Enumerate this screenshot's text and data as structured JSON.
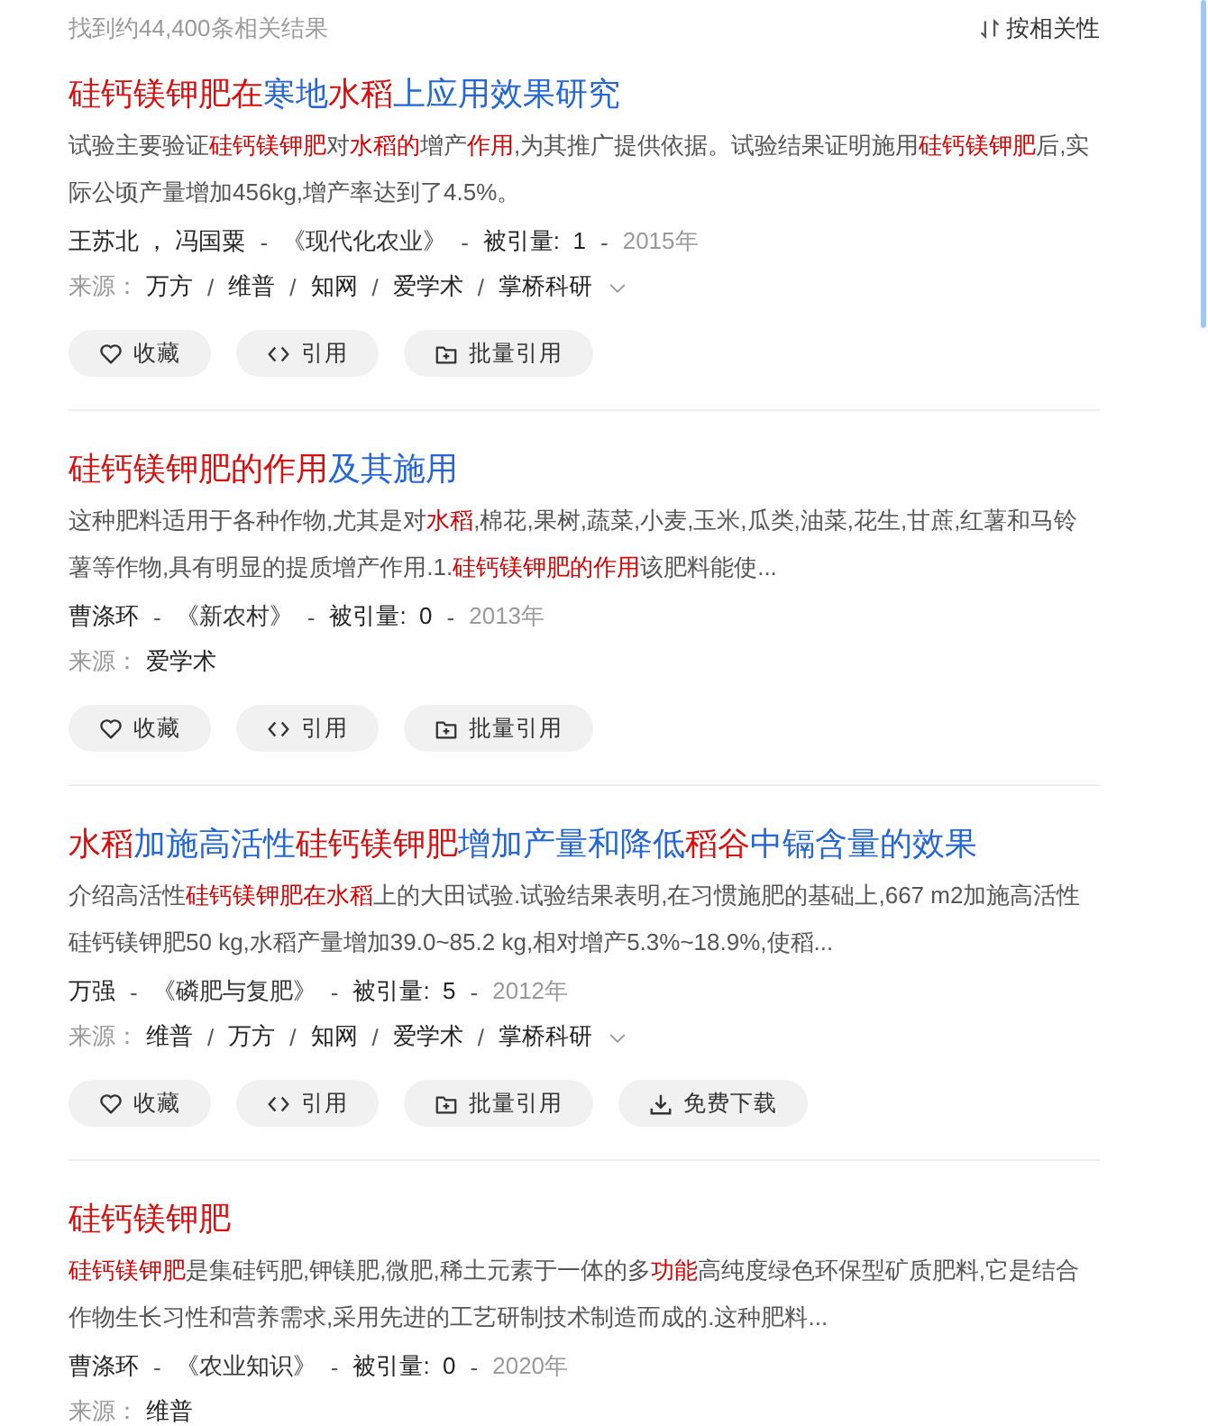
{
  "header": {
    "count": "找到约44,400条相关结果",
    "sort": "按相关性"
  },
  "results": [
    {
      "title": [
        {
          "text": "硅钙镁钾肥在",
          "highlight": true
        },
        {
          "text": "寒地",
          "highlight": false
        },
        {
          "text": "水稻",
          "highlight": true
        },
        {
          "text": "上应用效果研究",
          "highlight": false
        }
      ],
      "abstract": [
        {
          "text": "试验主要验证",
          "highlight": false
        },
        {
          "text": "硅钙镁钾肥",
          "highlight": true
        },
        {
          "text": "对",
          "highlight": false
        },
        {
          "text": "水稻的",
          "highlight": true
        },
        {
          "text": "增产",
          "highlight": false
        },
        {
          "text": "作用",
          "highlight": true
        },
        {
          "text": ",为其推广提供依据。试验结果证明施用",
          "highlight": false
        },
        {
          "text": "硅钙镁钾肥",
          "highlight": true
        },
        {
          "text": "后,实际公顷产量增加456kg,增产率达到了4.5%。",
          "highlight": false
        }
      ],
      "meta": [
        {
          "text": "王苏北 ， 冯国粟",
          "kind": "author"
        },
        {
          "text": "-",
          "kind": "sep"
        },
        {
          "text": "《现代化农业》",
          "kind": "journal"
        },
        {
          "text": "-",
          "kind": "sep"
        },
        {
          "text": "被引量:  1",
          "kind": "cited"
        },
        {
          "text": "-",
          "kind": "sep"
        },
        {
          "text": "2015年",
          "kind": "year"
        }
      ],
      "source": {
        "label": "来源：",
        "expandable": true,
        "items": [
          {
            "text": "万方",
            "kind": "site"
          },
          {
            "text": "/",
            "kind": "sep"
          },
          {
            "text": "维普",
            "kind": "site"
          },
          {
            "text": "/",
            "kind": "sep"
          },
          {
            "text": "知网",
            "kind": "site"
          },
          {
            "text": "/",
            "kind": "sep"
          },
          {
            "text": "爱学术",
            "kind": "site"
          },
          {
            "text": "/",
            "kind": "sep"
          },
          {
            "text": "掌桥科研",
            "kind": "site"
          }
        ]
      },
      "buttons": [
        {
          "label": "收藏",
          "kind": "favorite"
        },
        {
          "label": "引用",
          "kind": "cite"
        },
        {
          "label": "批量引用",
          "kind": "batch"
        }
      ]
    },
    {
      "title": [
        {
          "text": "硅钙镁钾肥的作用",
          "highlight": true
        },
        {
          "text": "及其施用",
          "highlight": false
        }
      ],
      "abstract": [
        {
          "text": "这种肥料适用于各种作物,尤其是对",
          "highlight": false
        },
        {
          "text": "水稻",
          "highlight": true
        },
        {
          "text": ",棉花,果树,蔬菜,小麦,玉米,瓜类,油菜,花生,甘蔗,红薯和马铃薯等作物,具有明显的提质增产作用.1.",
          "highlight": false
        },
        {
          "text": "硅钙镁钾肥的作用",
          "highlight": true
        },
        {
          "text": "该肥料能使...",
          "highlight": false
        }
      ],
      "meta": [
        {
          "text": "曹涤环",
          "kind": "author"
        },
        {
          "text": "-",
          "kind": "sep"
        },
        {
          "text": "《新农村》",
          "kind": "journal"
        },
        {
          "text": "-",
          "kind": "sep"
        },
        {
          "text": "被引量:  0",
          "kind": "cited"
        },
        {
          "text": "-",
          "kind": "sep"
        },
        {
          "text": "2013年",
          "kind": "year"
        }
      ],
      "source": {
        "label": "来源：",
        "expandable": false,
        "items": [
          {
            "text": "爱学术",
            "kind": "site"
          }
        ]
      },
      "buttons": [
        {
          "label": "收藏",
          "kind": "favorite"
        },
        {
          "label": "引用",
          "kind": "cite"
        },
        {
          "label": "批量引用",
          "kind": "batch"
        }
      ]
    },
    {
      "title": [
        {
          "text": "水稻",
          "highlight": true
        },
        {
          "text": "加施高活性",
          "highlight": false
        },
        {
          "text": "硅钙镁钾肥",
          "highlight": true
        },
        {
          "text": "增加产量和降低",
          "highlight": false
        },
        {
          "text": "稻谷",
          "highlight": true
        },
        {
          "text": "中镉含量的效果",
          "highlight": false
        }
      ],
      "abstract": [
        {
          "text": "介绍高活性",
          "highlight": false
        },
        {
          "text": "硅钙镁钾肥在水稻",
          "highlight": true
        },
        {
          "text": "上的大田试验.试验结果表明,在习惯施肥的基础上,667 m2加施高活性硅钙镁钾肥50 kg,水稻产量增加39.0~85.2 kg,相对增产5.3%~18.9%,使稻...",
          "highlight": false
        }
      ],
      "meta": [
        {
          "text": "万强",
          "kind": "author"
        },
        {
          "text": "-",
          "kind": "sep"
        },
        {
          "text": "《磷肥与复肥》",
          "kind": "journal"
        },
        {
          "text": "-",
          "kind": "sep"
        },
        {
          "text": "被引量:  5",
          "kind": "cited"
        },
        {
          "text": "-",
          "kind": "sep"
        },
        {
          "text": "2012年",
          "kind": "year"
        }
      ],
      "source": {
        "label": "来源：",
        "expandable": true,
        "items": [
          {
            "text": "维普",
            "kind": "site"
          },
          {
            "text": "/",
            "kind": "sep"
          },
          {
            "text": "万方",
            "kind": "site"
          },
          {
            "text": "/",
            "kind": "sep"
          },
          {
            "text": "知网",
            "kind": "site"
          },
          {
            "text": "/",
            "kind": "sep"
          },
          {
            "text": "爱学术",
            "kind": "site"
          },
          {
            "text": "/",
            "kind": "sep"
          },
          {
            "text": "掌桥科研",
            "kind": "site"
          }
        ]
      },
      "buttons": [
        {
          "label": "收藏",
          "kind": "favorite"
        },
        {
          "label": "引用",
          "kind": "cite"
        },
        {
          "label": "批量引用",
          "kind": "batch"
        },
        {
          "label": "免费下载",
          "kind": "download"
        }
      ]
    },
    {
      "title": [
        {
          "text": "硅钙镁钾肥",
          "highlight": true
        }
      ],
      "abstract": [
        {
          "text": "硅钙镁钾肥",
          "highlight": true
        },
        {
          "text": "是集硅钙肥,钾镁肥,微肥,稀土元素于一体的多",
          "highlight": false
        },
        {
          "text": "功能",
          "highlight": true
        },
        {
          "text": "高纯度绿色环保型矿质肥料,它是结合作物生长习性和营养需求,采用先进的工艺研制技术制造而成的.这种肥料...",
          "highlight": false
        }
      ],
      "meta": [
        {
          "text": "曹涤环",
          "kind": "author"
        },
        {
          "text": "-",
          "kind": "sep"
        },
        {
          "text": "《农业知识》",
          "kind": "journal"
        },
        {
          "text": "-",
          "kind": "sep"
        },
        {
          "text": "被引量:  0",
          "kind": "cited"
        },
        {
          "text": "-",
          "kind": "sep"
        },
        {
          "text": "2020年",
          "kind": "year"
        }
      ],
      "source": {
        "label": "来源：",
        "expandable": false,
        "items": [
          {
            "text": "维普",
            "kind": "site"
          }
        ]
      }
    }
  ]
}
